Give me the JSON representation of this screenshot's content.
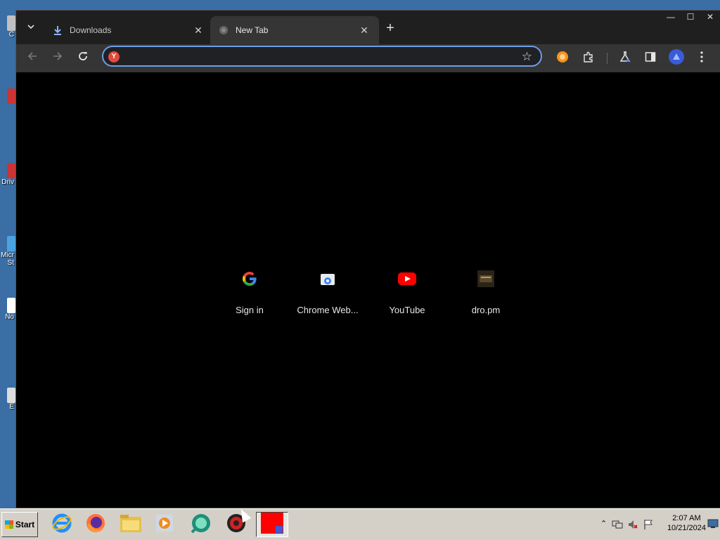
{
  "desktop": {
    "icon_labels": [
      "C",
      "",
      "Driv",
      "Micr St",
      "No",
      "E"
    ]
  },
  "browser": {
    "tabs": [
      {
        "title": "Downloads",
        "close": "✕",
        "active": false
      },
      {
        "title": "New Tab",
        "close": "✕",
        "active": true
      }
    ],
    "new_tab_label": "+",
    "tab_search_label": "⌄",
    "window_controls": {
      "minimize": "—",
      "maximize": "☐",
      "close": "✕"
    },
    "address_bar": {
      "value": "",
      "placeholder": ""
    },
    "omnibox_icon_letter": "Y",
    "accent_color": "#6d9ee8"
  },
  "new_tab": {
    "shortcuts": [
      {
        "label": "Sign in",
        "icon": "google-icon"
      },
      {
        "label": "Chrome Web...",
        "icon": "chrome-web-store-icon"
      },
      {
        "label": "YouTube",
        "icon": "youtube-icon"
      },
      {
        "label": "dro.pm",
        "icon": "dro-pm-icon"
      }
    ]
  },
  "taskbar": {
    "start_label": "Start",
    "apps": [
      "internet-explorer-icon",
      "firefox-icon",
      "file-explorer-icon",
      "media-player-icon",
      "app-icon",
      "security-app-icon",
      "chrome-window-icon"
    ],
    "clock_time": "2:07 AM",
    "clock_date": "10/21/2024"
  }
}
